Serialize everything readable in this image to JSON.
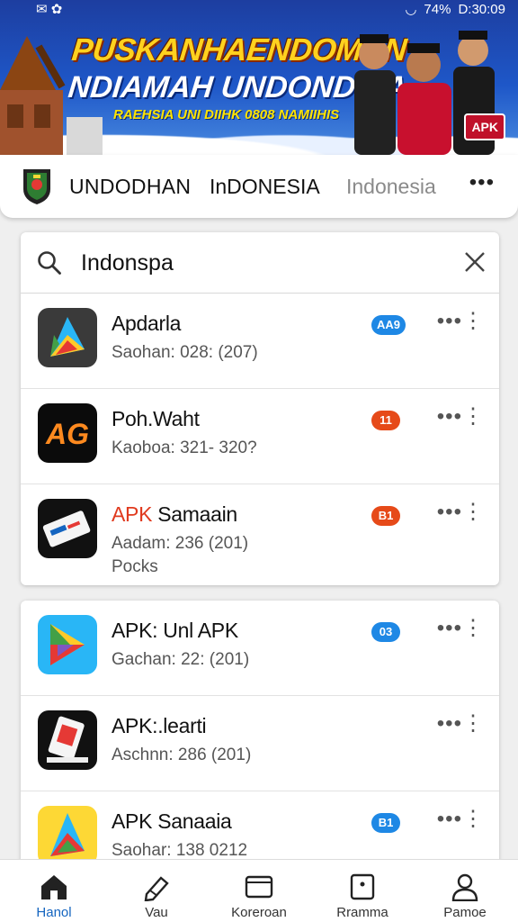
{
  "status_bar": {
    "signal": "74%",
    "time": "D:30:09"
  },
  "banner": {
    "title": "PUSKANHAENDOMAN",
    "subtitle": "NDIAMAH UNDONDSIA",
    "tagline": "RAEHSIA UNI DIIHK 0808 NAMIIHIS",
    "badge": "APK"
  },
  "navbar": {
    "tabs": [
      "UNDODHAN",
      "InDONESIA",
      "Indonesia"
    ],
    "more": "•••"
  },
  "search": {
    "value": "Indonspa"
  },
  "results": [
    {
      "name": "Apdarla",
      "accent": "",
      "meta": "Saohan: 028: (207)",
      "meta2": "",
      "badge": "AA9",
      "badge_color": "#1e88e5",
      "icon": "play-triangle-icon"
    },
    {
      "name": "Poh.Waht",
      "accent": "",
      "meta": "Kaoboa: 321- 320?",
      "meta2": "",
      "badge": "11",
      "badge_color": "#e64a19",
      "icon": "ag-logo-icon"
    },
    {
      "name": " Samaain",
      "accent": "APK",
      "meta": "Aadam: 236 (201)",
      "meta2": "Pocks",
      "badge": "B1",
      "badge_color": "#e64a19",
      "icon": "card-icon"
    },
    {
      "name": "APK: Unl APK",
      "accent": "",
      "meta": "Gachan: 22: (201)",
      "meta2": "",
      "badge": "03",
      "badge_color": "#1e88e5",
      "icon": "play-triangle-icon"
    },
    {
      "name": "APK:.learti",
      "accent": "",
      "meta": "Aschnn: 286 (201)",
      "meta2": "",
      "badge": "",
      "badge_color": "",
      "icon": "card-icon"
    },
    {
      "name": "APK Sanaaia",
      "accent": "",
      "meta": "Saohar: 138 0212",
      "meta2": "",
      "badge": "B1",
      "badge_color": "#1e88e5",
      "icon": "play-triangle-icon"
    }
  ],
  "bottom_nav": [
    {
      "label": "Hanol",
      "icon": "home-icon",
      "active": true
    },
    {
      "label": "Vau",
      "icon": "edit-icon",
      "active": false
    },
    {
      "label": "Koreroan",
      "icon": "window-icon",
      "active": false
    },
    {
      "label": "Rramma",
      "icon": "square-dot-icon",
      "active": false
    },
    {
      "label": "Pamoe",
      "icon": "person-icon",
      "active": false
    }
  ],
  "colors": {
    "accent": "#1565c0",
    "banner_yellow": "#ffd21f",
    "red": "#e03a1e"
  }
}
